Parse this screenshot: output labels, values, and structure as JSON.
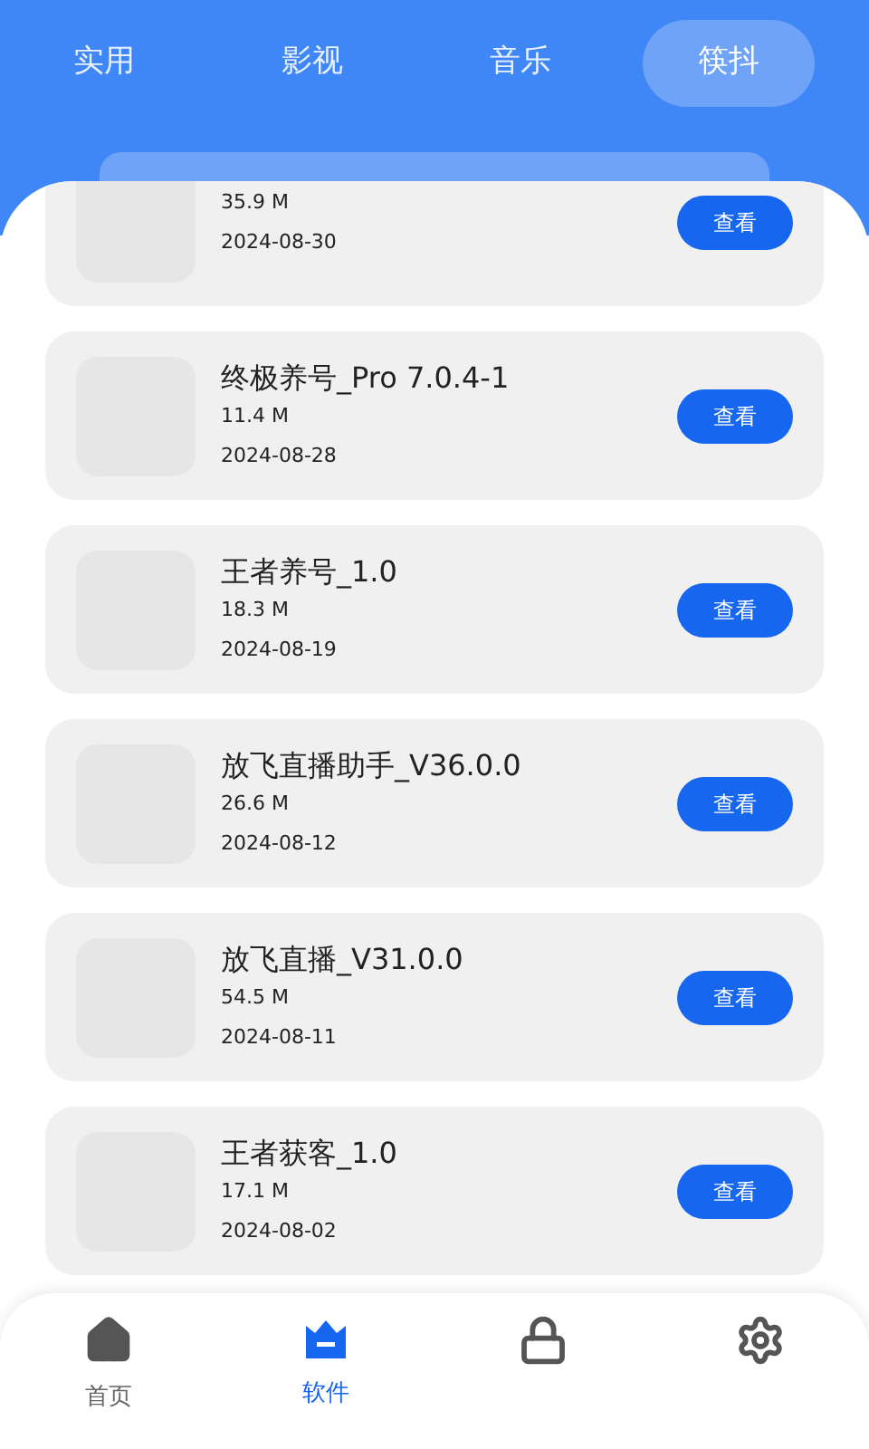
{
  "tabs": [
    {
      "label": "实用",
      "selected": false
    },
    {
      "label": "影视",
      "selected": false
    },
    {
      "label": "音乐",
      "selected": false
    },
    {
      "label": "筷抖",
      "selected": true
    }
  ],
  "apps": [
    {
      "size": "35.9 M",
      "date": "2024-08-30",
      "button": "查看"
    },
    {
      "name": "终极养号_Pro 7.0.4-1",
      "size": "11.4 M",
      "date": "2024-08-28",
      "button": "查看"
    },
    {
      "name": "王者养号_1.0",
      "size": "18.3 M",
      "date": "2024-08-19",
      "button": "查看"
    },
    {
      "name": "放飞直播助手_V36.0.0",
      "size": "26.6 M",
      "date": "2024-08-12",
      "button": "查看"
    },
    {
      "name": "放飞直播_V31.0.0",
      "size": "54.5 M",
      "date": "2024-08-11",
      "button": "查看"
    },
    {
      "name": "王者获客_1.0",
      "size": "17.1 M",
      "date": "2024-08-02",
      "button": "查看"
    }
  ],
  "nav": [
    {
      "kind": "home",
      "label": "首页",
      "selected": false
    },
    {
      "kind": "software",
      "label": "软件",
      "selected": true
    },
    {
      "kind": "lock",
      "selected": false
    },
    {
      "kind": "settings",
      "selected": false
    }
  ]
}
